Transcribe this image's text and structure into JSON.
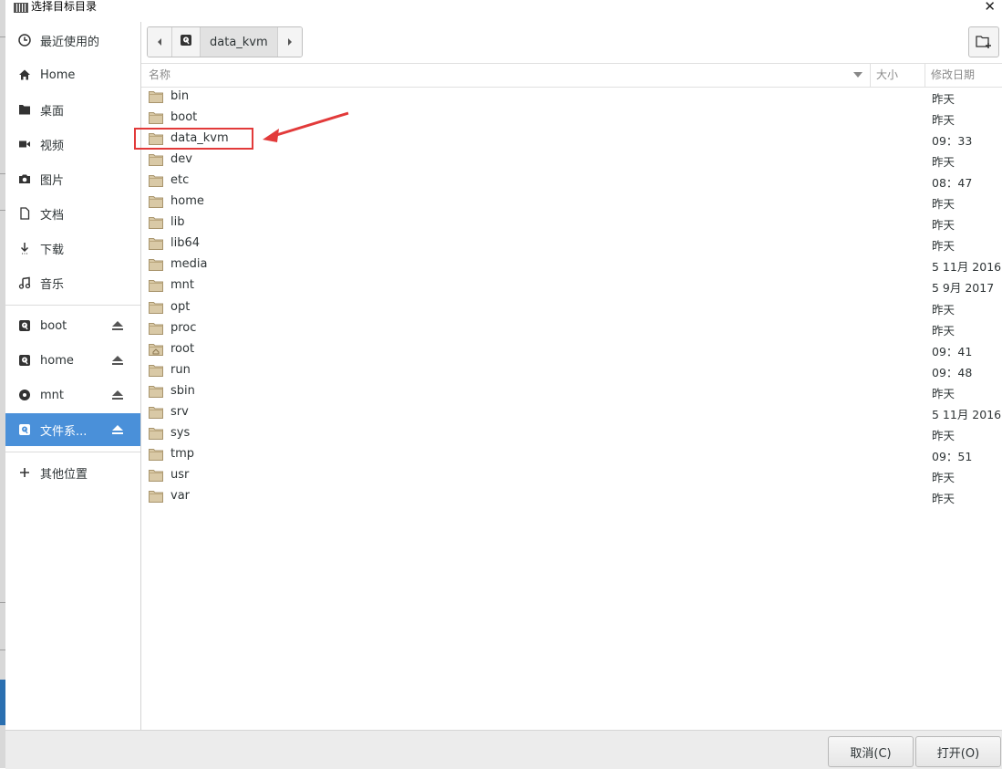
{
  "window": {
    "title": "选择目标目录"
  },
  "sidebar": {
    "places": [
      {
        "label": "最近使用的",
        "icon": "clock-icon"
      },
      {
        "label": "Home",
        "icon": "home-icon"
      },
      {
        "label": "桌面",
        "icon": "desktop-folder-icon"
      },
      {
        "label": "视频",
        "icon": "video-icon"
      },
      {
        "label": "图片",
        "icon": "camera-icon"
      },
      {
        "label": "文档",
        "icon": "document-icon"
      },
      {
        "label": "下载",
        "icon": "download-icon"
      },
      {
        "label": "音乐",
        "icon": "music-icon"
      }
    ],
    "devices": [
      {
        "label": "boot",
        "icon": "drive-icon",
        "eject": true
      },
      {
        "label": "home",
        "icon": "drive-icon",
        "eject": true
      },
      {
        "label": "mnt",
        "icon": "disc-icon",
        "eject": true
      },
      {
        "label": "文件系...",
        "icon": "drive-icon",
        "eject": true,
        "active": true
      }
    ],
    "other": {
      "label": "其他位置",
      "icon": "plus-icon"
    }
  },
  "pathbar": {
    "crumb": "data_kvm"
  },
  "columns": {
    "name": "名称",
    "size": "大小",
    "modified": "修改日期"
  },
  "files": [
    {
      "name": "bin",
      "date": "昨天"
    },
    {
      "name": "boot",
      "date": "昨天"
    },
    {
      "name": "data_kvm",
      "date": "09：33"
    },
    {
      "name": "dev",
      "date": "昨天"
    },
    {
      "name": "etc",
      "date": "08：47"
    },
    {
      "name": "home",
      "date": "昨天"
    },
    {
      "name": "lib",
      "date": "昨天"
    },
    {
      "name": "lib64",
      "date": "昨天"
    },
    {
      "name": "media",
      "date": "5 11月 2016"
    },
    {
      "name": "mnt",
      "date": "5 9月 2017"
    },
    {
      "name": "opt",
      "date": "昨天"
    },
    {
      "name": "proc",
      "date": "昨天"
    },
    {
      "name": "root",
      "date": "09：41",
      "home_folder": true
    },
    {
      "name": "run",
      "date": "09：48"
    },
    {
      "name": "sbin",
      "date": "昨天"
    },
    {
      "name": "srv",
      "date": "5 11月 2016"
    },
    {
      "name": "sys",
      "date": "昨天"
    },
    {
      "name": "tmp",
      "date": "09：51"
    },
    {
      "name": "usr",
      "date": "昨天"
    },
    {
      "name": "var",
      "date": "昨天"
    }
  ],
  "buttons": {
    "cancel": "取消(C)",
    "open": "打开(O)"
  },
  "colors": {
    "accent": "#4a90d9",
    "annotation": "#e23a3a",
    "folder": "#d9c9a6"
  }
}
